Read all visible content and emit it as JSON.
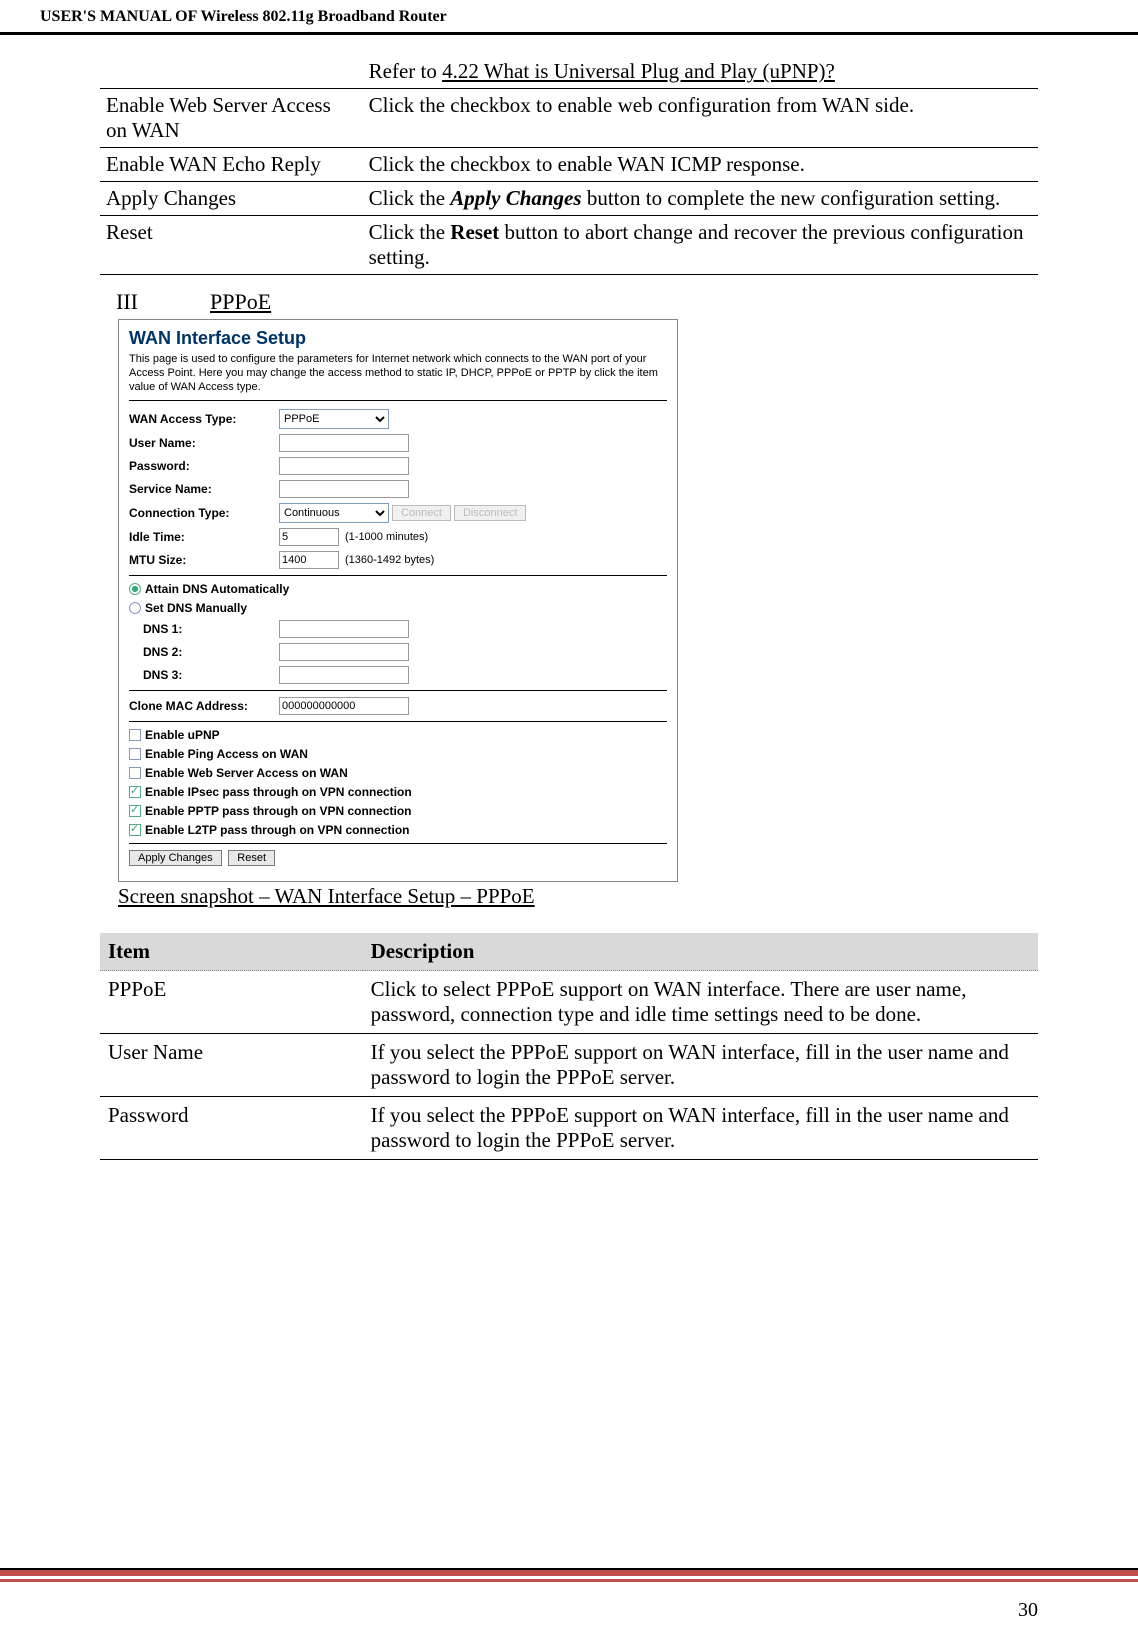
{
  "header": "USER'S MANUAL OF Wireless 802.11g Broadband Router",
  "topTable": [
    {
      "label": "",
      "valuePre": "Refer to ",
      "valueLink": "4.22 What is Universal Plug and Play (uPNP)?"
    },
    {
      "label": "Enable Web Server Access on WAN",
      "value": "Click the checkbox to enable web configuration from WAN side."
    },
    {
      "label": "Enable WAN Echo Reply",
      "value": "Click the checkbox to enable WAN ICMP response."
    },
    {
      "label": "Apply Changes",
      "valuePre": "Click the ",
      "bold": "Apply Changes",
      "valuePost": " button to complete the new configuration setting."
    },
    {
      "label": "Reset",
      "valuePre": "Click the ",
      "bold": "Reset",
      "valuePost": " button to abort change and recover the previous configuration setting."
    }
  ],
  "section": {
    "num": "III",
    "title": "PPPoE"
  },
  "ss": {
    "title": "WAN Interface Setup",
    "desc": "This page is used to configure the parameters for Internet network which connects to the WAN port of your Access Point. Here you may change the access method to static IP, DHCP, PPPoE or PPTP by click the item value of WAN Access type.",
    "rows": {
      "wanAccess": {
        "label": "WAN Access Type:",
        "value": "PPPoE"
      },
      "user": {
        "label": "User Name:"
      },
      "pass": {
        "label": "Password:"
      },
      "service": {
        "label": "Service Name:"
      },
      "conn": {
        "label": "Connection Type:",
        "value": "Continuous",
        "btn1": "Connect",
        "btn2": "Disconnect"
      },
      "idle": {
        "label": "Idle Time:",
        "value": "5",
        "meta": "(1-1000 minutes)"
      },
      "mtu": {
        "label": "MTU Size:",
        "value": "1400",
        "meta": "(1360-1492 bytes)"
      },
      "radioAuto": "Attain DNS Automatically",
      "radioManual": "Set DNS Manually",
      "dns1": "DNS 1:",
      "dns2": "DNS 2:",
      "dns3": "DNS 3:",
      "clone": {
        "label": "Clone MAC Address:",
        "value": "000000000000"
      },
      "cUpnp": "Enable uPNP",
      "cPing": "Enable Ping Access on WAN",
      "cWeb": "Enable Web Server Access on WAN",
      "cIpsec": "Enable IPsec pass through on VPN connection",
      "cPptp": "Enable PPTP pass through on VPN connection",
      "cL2tp": "Enable L2TP pass through on VPN connection",
      "apply": "Apply Changes",
      "reset": "Reset"
    }
  },
  "caption": "Screen snapshot – WAN Interface Setup – PPPoE",
  "descTable": {
    "head": {
      "c1": "Item",
      "c2": "Description"
    },
    "rows": [
      {
        "c1": "PPPoE",
        "c2": "Click to select PPPoE support on WAN interface. There are user name, password, connection type and idle time settings need to be done."
      },
      {
        "c1": "User Name",
        "c2": "If you select the PPPoE support on WAN interface, fill in the user name and password to login the PPPoE server."
      },
      {
        "c1": "Password",
        "c2": "If you select the PPPoE support on WAN interface, fill in the user name and password to login the PPPoE server."
      }
    ]
  },
  "pageNum": "30"
}
